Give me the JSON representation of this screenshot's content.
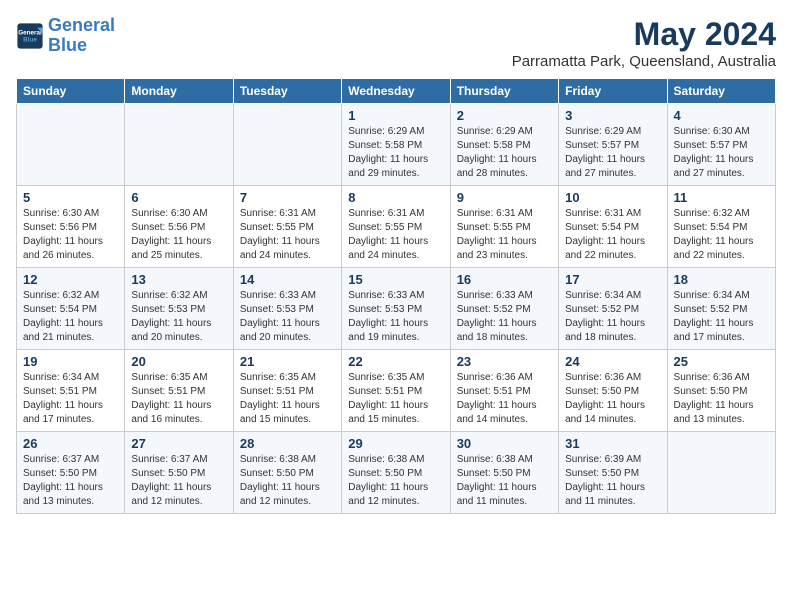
{
  "logo": {
    "line1": "General",
    "line2": "Blue"
  },
  "title": "May 2024",
  "subtitle": "Parramatta Park, Queensland, Australia",
  "days_of_week": [
    "Sunday",
    "Monday",
    "Tuesday",
    "Wednesday",
    "Thursday",
    "Friday",
    "Saturday"
  ],
  "weeks": [
    [
      {
        "day": "",
        "info": ""
      },
      {
        "day": "",
        "info": ""
      },
      {
        "day": "",
        "info": ""
      },
      {
        "day": "1",
        "info": "Sunrise: 6:29 AM\nSunset: 5:58 PM\nDaylight: 11 hours\nand 29 minutes."
      },
      {
        "day": "2",
        "info": "Sunrise: 6:29 AM\nSunset: 5:58 PM\nDaylight: 11 hours\nand 28 minutes."
      },
      {
        "day": "3",
        "info": "Sunrise: 6:29 AM\nSunset: 5:57 PM\nDaylight: 11 hours\nand 27 minutes."
      },
      {
        "day": "4",
        "info": "Sunrise: 6:30 AM\nSunset: 5:57 PM\nDaylight: 11 hours\nand 27 minutes."
      }
    ],
    [
      {
        "day": "5",
        "info": "Sunrise: 6:30 AM\nSunset: 5:56 PM\nDaylight: 11 hours\nand 26 minutes."
      },
      {
        "day": "6",
        "info": "Sunrise: 6:30 AM\nSunset: 5:56 PM\nDaylight: 11 hours\nand 25 minutes."
      },
      {
        "day": "7",
        "info": "Sunrise: 6:31 AM\nSunset: 5:55 PM\nDaylight: 11 hours\nand 24 minutes."
      },
      {
        "day": "8",
        "info": "Sunrise: 6:31 AM\nSunset: 5:55 PM\nDaylight: 11 hours\nand 24 minutes."
      },
      {
        "day": "9",
        "info": "Sunrise: 6:31 AM\nSunset: 5:55 PM\nDaylight: 11 hours\nand 23 minutes."
      },
      {
        "day": "10",
        "info": "Sunrise: 6:31 AM\nSunset: 5:54 PM\nDaylight: 11 hours\nand 22 minutes."
      },
      {
        "day": "11",
        "info": "Sunrise: 6:32 AM\nSunset: 5:54 PM\nDaylight: 11 hours\nand 22 minutes."
      }
    ],
    [
      {
        "day": "12",
        "info": "Sunrise: 6:32 AM\nSunset: 5:54 PM\nDaylight: 11 hours\nand 21 minutes."
      },
      {
        "day": "13",
        "info": "Sunrise: 6:32 AM\nSunset: 5:53 PM\nDaylight: 11 hours\nand 20 minutes."
      },
      {
        "day": "14",
        "info": "Sunrise: 6:33 AM\nSunset: 5:53 PM\nDaylight: 11 hours\nand 20 minutes."
      },
      {
        "day": "15",
        "info": "Sunrise: 6:33 AM\nSunset: 5:53 PM\nDaylight: 11 hours\nand 19 minutes."
      },
      {
        "day": "16",
        "info": "Sunrise: 6:33 AM\nSunset: 5:52 PM\nDaylight: 11 hours\nand 18 minutes."
      },
      {
        "day": "17",
        "info": "Sunrise: 6:34 AM\nSunset: 5:52 PM\nDaylight: 11 hours\nand 18 minutes."
      },
      {
        "day": "18",
        "info": "Sunrise: 6:34 AM\nSunset: 5:52 PM\nDaylight: 11 hours\nand 17 minutes."
      }
    ],
    [
      {
        "day": "19",
        "info": "Sunrise: 6:34 AM\nSunset: 5:51 PM\nDaylight: 11 hours\nand 17 minutes."
      },
      {
        "day": "20",
        "info": "Sunrise: 6:35 AM\nSunset: 5:51 PM\nDaylight: 11 hours\nand 16 minutes."
      },
      {
        "day": "21",
        "info": "Sunrise: 6:35 AM\nSunset: 5:51 PM\nDaylight: 11 hours\nand 15 minutes."
      },
      {
        "day": "22",
        "info": "Sunrise: 6:35 AM\nSunset: 5:51 PM\nDaylight: 11 hours\nand 15 minutes."
      },
      {
        "day": "23",
        "info": "Sunrise: 6:36 AM\nSunset: 5:51 PM\nDaylight: 11 hours\nand 14 minutes."
      },
      {
        "day": "24",
        "info": "Sunrise: 6:36 AM\nSunset: 5:50 PM\nDaylight: 11 hours\nand 14 minutes."
      },
      {
        "day": "25",
        "info": "Sunrise: 6:36 AM\nSunset: 5:50 PM\nDaylight: 11 hours\nand 13 minutes."
      }
    ],
    [
      {
        "day": "26",
        "info": "Sunrise: 6:37 AM\nSunset: 5:50 PM\nDaylight: 11 hours\nand 13 minutes."
      },
      {
        "day": "27",
        "info": "Sunrise: 6:37 AM\nSunset: 5:50 PM\nDaylight: 11 hours\nand 12 minutes."
      },
      {
        "day": "28",
        "info": "Sunrise: 6:38 AM\nSunset: 5:50 PM\nDaylight: 11 hours\nand 12 minutes."
      },
      {
        "day": "29",
        "info": "Sunrise: 6:38 AM\nSunset: 5:50 PM\nDaylight: 11 hours\nand 12 minutes."
      },
      {
        "day": "30",
        "info": "Sunrise: 6:38 AM\nSunset: 5:50 PM\nDaylight: 11 hours\nand 11 minutes."
      },
      {
        "day": "31",
        "info": "Sunrise: 6:39 AM\nSunset: 5:50 PM\nDaylight: 11 hours\nand 11 minutes."
      },
      {
        "day": "",
        "info": ""
      }
    ]
  ]
}
